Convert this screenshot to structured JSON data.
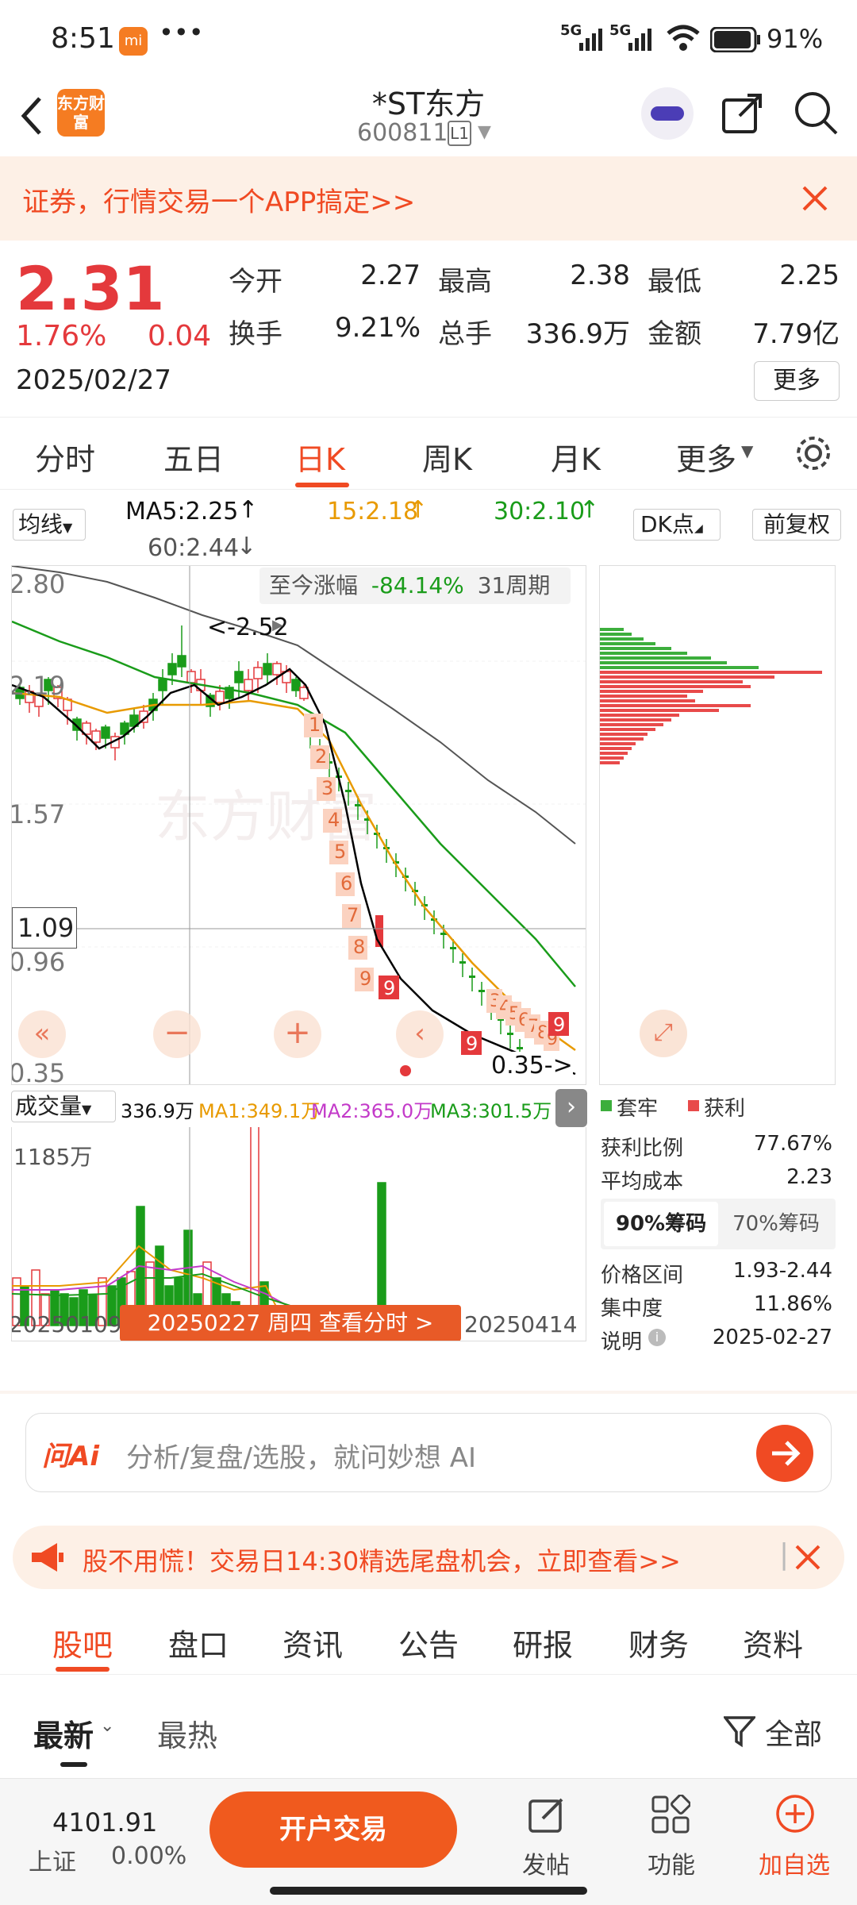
{
  "status": {
    "time": "8:51",
    "battery": "91%",
    "signal1": "5G",
    "signal2": "5G"
  },
  "nav": {
    "app_logo": "东方财富",
    "title": "*ST东方",
    "code": "600811",
    "level": "L1"
  },
  "banner": {
    "text": "证券，行情交易一个APP搞定>>"
  },
  "quote": {
    "price": "2.31",
    "change_pct": "1.76%",
    "change": "0.04",
    "date": "2025/02/27",
    "open_label": "今开",
    "open": "2.27",
    "high_label": "最高",
    "high": "2.38",
    "low_label": "最低",
    "low": "2.25",
    "turnover_label": "换手",
    "turnover": "9.21%",
    "volume_label": "总手",
    "volume": "336.9万",
    "amount_label": "金额",
    "amount": "7.79亿",
    "more": "更多"
  },
  "period_tabs": [
    "分时",
    "五日",
    "日K",
    "周K",
    "月K",
    "更多"
  ],
  "ma": {
    "selector": "均线",
    "ma5": "MA5:2.25",
    "ma15": "15:2.18",
    "ma30": "30:2.10",
    "ma60": "60:2.44",
    "dk": "DK点",
    "fq": "前复权"
  },
  "chart": {
    "prices": [
      "2.80",
      "2.19",
      "1.57",
      "1.09",
      "0.96",
      "0.35"
    ],
    "high_marker": "<-2.52",
    "low_marker": "0.35->",
    "range_label": "至今涨幅",
    "range_value": "-84.14%",
    "range_period": "31周期",
    "watermark": "东方财富",
    "cursor_price": "1.09",
    "td_up": [
      "1",
      "2",
      "3",
      "4",
      "5",
      "6",
      "7",
      "8",
      "9"
    ],
    "td_down": [
      "1",
      "2",
      "3",
      "4",
      "5",
      "6",
      "7",
      "8",
      "9"
    ],
    "td_late": [
      "3",
      "4",
      "5",
      "6",
      "7",
      "8",
      "9"
    ],
    "td_mid": [
      "9",
      "2"
    ]
  },
  "colors": {
    "accent": "#f04a23",
    "up": "#e4393c",
    "down": "#1a9c1a",
    "ma5": "#000000",
    "ma15": "#e89a00",
    "ma30": "#1a9c1a",
    "ma60": "#555555"
  },
  "chip": {
    "legend_trap": "套牢",
    "legend_profit": "获利",
    "profit_ratio_label": "获利比例",
    "profit_ratio": "77.67%",
    "avg_cost_label": "平均成本",
    "avg_cost": "2.23",
    "tab90": "90%筹码",
    "tab70": "70%筹码",
    "range_label": "价格区间",
    "range": "1.93-2.44",
    "concentration_label": "集中度",
    "concentration": "11.86%",
    "note_label": "说明",
    "note": "2025-02-27"
  },
  "volume": {
    "selector": "成交量",
    "current": "336.9万",
    "ma1": "MA1:349.1万",
    "ma2": "MA2:365.0万",
    "ma3": "MA3:301.5万",
    "max": "1185万",
    "date_left": "20250109",
    "date_right": "20250414",
    "tooltip": "20250227 周四 查看分时 >"
  },
  "ai": {
    "logo": "问Ai",
    "placeholder": "分析/复盘/选股，就问妙想 AI"
  },
  "promo": {
    "text": "股不用慌！交易日14:30精选尾盘机会，立即查看>>"
  },
  "bottom_tabs": [
    "股吧",
    "盘口",
    "资讯",
    "公告",
    "研报",
    "财务",
    "资料"
  ],
  "sort": {
    "latest": "最新",
    "hot": "最热",
    "filter": "全部"
  },
  "footer": {
    "index_value": "4101.91",
    "index_name": "上证",
    "index_change": "0.00%",
    "trade": "开户交易",
    "post": "发帖",
    "func": "功能",
    "add": "加自选"
  }
}
